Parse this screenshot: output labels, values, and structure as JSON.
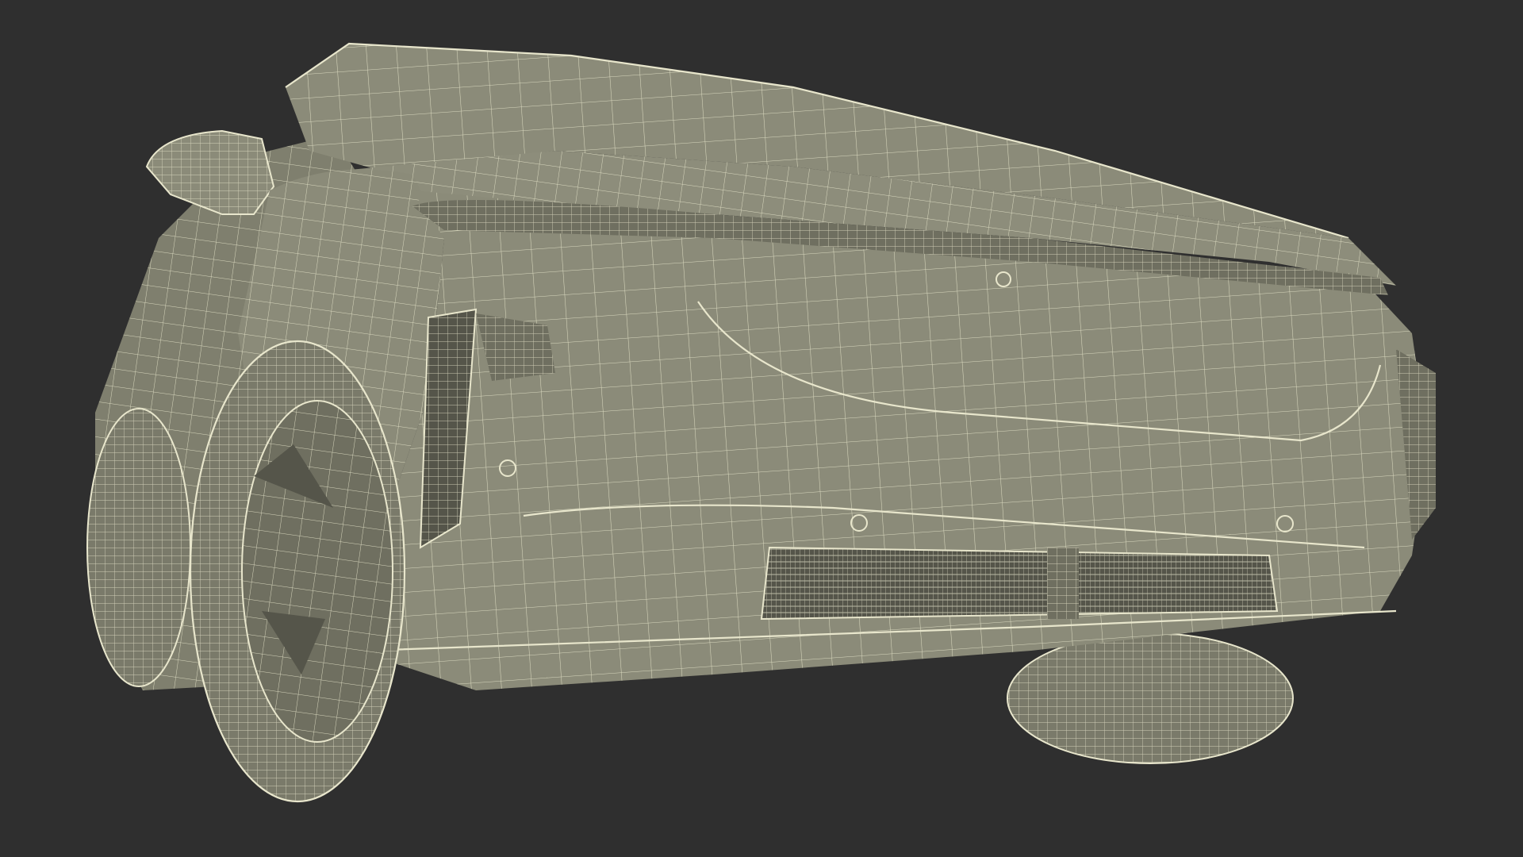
{
  "scene": {
    "subject": "car-wireframe-render",
    "colors": {
      "background": "#2f2f2f",
      "body_fill": "#8b8b79",
      "body_shadow": "#6f6f60",
      "tire_fill": "#7a7a6a",
      "opening_fill": "#55554a",
      "wire": "#e8e6cc"
    }
  }
}
